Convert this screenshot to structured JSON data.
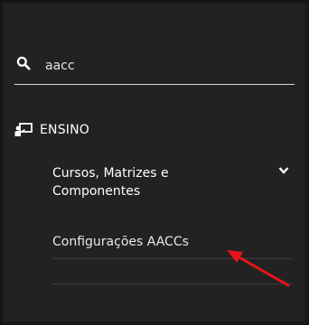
{
  "search": {
    "value": "aacc",
    "icon": "search-icon"
  },
  "menu": {
    "ensino": {
      "label": "ENSINO",
      "icon": "classroom-icon"
    },
    "submenu": {
      "label": "Cursos, Matrizes e Componentes",
      "icon": "chevron-down-icon",
      "items": [
        {
          "label": "Configurações AACCs"
        }
      ]
    }
  },
  "colors": {
    "sidebar_background": "#222222",
    "text": "#ffffff",
    "annotation_arrow": "#e8141b"
  }
}
